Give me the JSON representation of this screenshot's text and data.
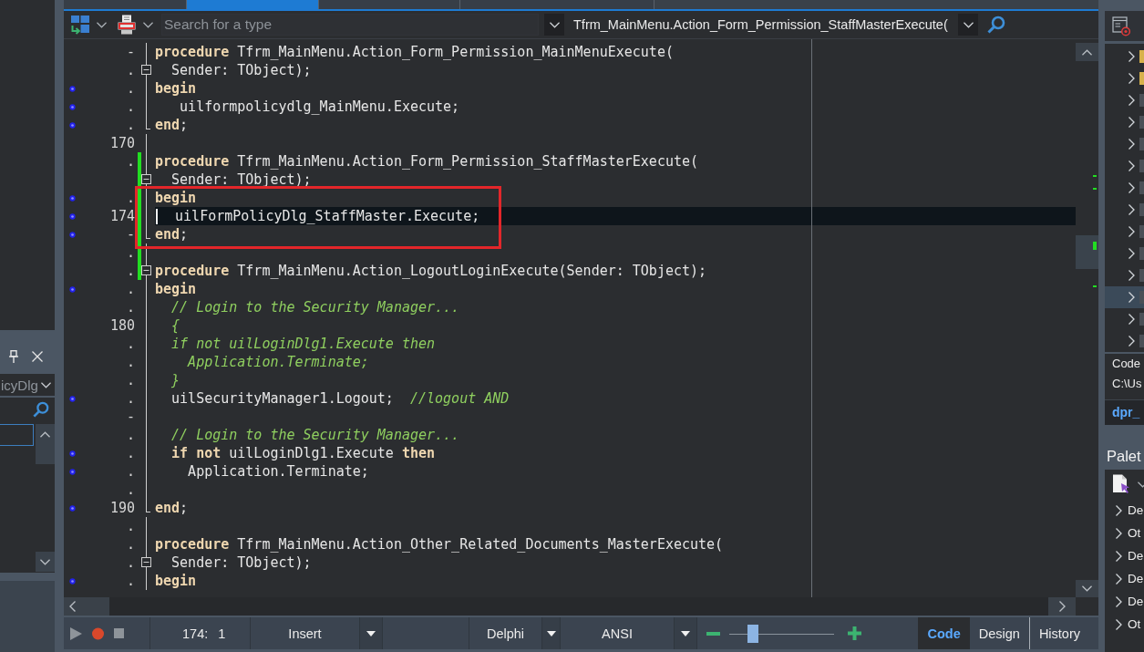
{
  "left_panel": {
    "combo": "icyDlg"
  },
  "editor_tabs": [
    {
      "selected": false
    },
    {
      "selected": true
    },
    {
      "selected": false
    },
    {
      "selected": false
    }
  ],
  "toolbar": {
    "search": {
      "placeholder": "Search for a type"
    },
    "method": "Tfrm_MainMenu.Action_Form_Permission_StaffMasterExecute("
  },
  "lines": [
    {
      "gutter": "-",
      "executable": false,
      "modified": false,
      "current": false,
      "kind": "line",
      "code": [
        {
          "kind": "keyword",
          "text": "procedure"
        },
        {
          "kind": "plain",
          "text": " Tfrm_MainMenu.Action_Form_Permission_MainMenuExecute("
        }
      ]
    },
    {
      "gutter": ".",
      "executable": false,
      "modified": false,
      "current": false,
      "kind": "box",
      "code": [
        {
          "kind": "plain",
          "text": "  Sender: TObject);"
        }
      ]
    },
    {
      "gutter": ".",
      "executable": true,
      "modified": false,
      "current": false,
      "kind": "line",
      "code": [
        {
          "kind": "keyword",
          "text": "begin"
        }
      ]
    },
    {
      "gutter": ".",
      "executable": true,
      "modified": false,
      "current": false,
      "kind": "line",
      "code": [
        {
          "kind": "plain",
          "text": "   uilformpolicydlg_MainMenu.Execute;"
        }
      ]
    },
    {
      "gutter": ".",
      "executable": true,
      "modified": false,
      "current": false,
      "kind": "end",
      "code": [
        {
          "kind": "keyword",
          "text": "end"
        },
        {
          "kind": "plain",
          "text": ";"
        }
      ]
    },
    {
      "gutter": "170",
      "executable": false,
      "modified": false,
      "current": false,
      "kind": "line"
    },
    {
      "gutter": ".",
      "executable": false,
      "modified": true,
      "current": false,
      "kind": "line",
      "code": [
        {
          "kind": "keyword",
          "text": "procedure"
        },
        {
          "kind": "plain",
          "text": " Tfrm_MainMenu.Action_Form_Permission_StaffMasterExecute("
        }
      ]
    },
    {
      "executable": false,
      "modified": true,
      "current": false,
      "kind": "box",
      "code": [
        {
          "kind": "plain",
          "text": "  Sender: TObject);"
        }
      ]
    },
    {
      "gutter": ".",
      "executable": true,
      "modified": true,
      "current": false,
      "kind": "line",
      "code": [
        {
          "kind": "keyword",
          "text": "begin"
        }
      ]
    },
    {
      "gutter": "174",
      "executable": true,
      "modified": true,
      "current": true,
      "kind": "line",
      "code": [
        {
          "kind": "plain",
          "text": "  uilFormPolicyDlg_StaffMaster.Execute;"
        }
      ]
    },
    {
      "gutter": "-",
      "executable": true,
      "modified": true,
      "current": false,
      "kind": "end",
      "code": [
        {
          "kind": "keyword",
          "text": "end"
        },
        {
          "kind": "plain",
          "text": ";"
        }
      ]
    },
    {
      "gutter": ".",
      "executable": false,
      "modified": true,
      "current": false,
      "kind": "line"
    },
    {
      "gutter": ".",
      "executable": false,
      "modified": true,
      "current": false,
      "kind": "box",
      "code": [
        {
          "kind": "keyword",
          "text": "procedure"
        },
        {
          "kind": "plain",
          "text": " Tfrm_MainMenu.Action_LogoutLoginExecute(Sender: TObject);"
        }
      ]
    },
    {
      "gutter": ".",
      "executable": true,
      "modified": false,
      "current": false,
      "kind": "line",
      "code": [
        {
          "kind": "keyword",
          "text": "begin"
        }
      ]
    },
    {
      "gutter": ".",
      "executable": false,
      "modified": false,
      "current": false,
      "kind": "line",
      "code": [
        {
          "kind": "comment",
          "text": "  // Login to the Security Manager..."
        }
      ]
    },
    {
      "gutter": "180",
      "executable": false,
      "modified": false,
      "current": false,
      "kind": "line",
      "code": [
        {
          "kind": "comment",
          "text": "  {"
        }
      ]
    },
    {
      "gutter": ".",
      "executable": false,
      "modified": false,
      "current": false,
      "kind": "line",
      "code": [
        {
          "kind": "comment",
          "text": "  if not uilLoginDlg1.Execute then"
        }
      ]
    },
    {
      "gutter": ".",
      "executable": false,
      "modified": false,
      "current": false,
      "kind": "line",
      "code": [
        {
          "kind": "comment",
          "text": "    Application.Terminate;"
        }
      ]
    },
    {
      "gutter": ".",
      "executable": false,
      "modified": false,
      "current": false,
      "kind": "line",
      "code": [
        {
          "kind": "comment",
          "text": "  }"
        }
      ]
    },
    {
      "gutter": ".",
      "executable": true,
      "modified": false,
      "current": false,
      "kind": "line",
      "code": [
        {
          "kind": "plain",
          "text": "  uilSecurityManager1.Logout;  "
        },
        {
          "kind": "comment",
          "text": "//logout AND"
        }
      ]
    },
    {
      "gutter": "-",
      "executable": false,
      "modified": false,
      "current": false,
      "kind": "line"
    },
    {
      "gutter": ".",
      "executable": false,
      "modified": false,
      "current": false,
      "kind": "line",
      "code": [
        {
          "kind": "comment",
          "text": "  // Login to the Security Manager..."
        }
      ]
    },
    {
      "gutter": ".",
      "executable": true,
      "modified": false,
      "current": false,
      "kind": "line",
      "code": [
        {
          "kind": "keyword",
          "text": "  if not"
        },
        {
          "kind": "plain",
          "text": " uilLoginDlg1.Execute "
        },
        {
          "kind": "keyword",
          "text": "then"
        }
      ]
    },
    {
      "gutter": ".",
      "executable": true,
      "modified": false,
      "current": false,
      "kind": "line",
      "code": [
        {
          "kind": "plain",
          "text": "    Application.Terminate;"
        }
      ]
    },
    {
      "gutter": ".",
      "executable": false,
      "modified": false,
      "current": false,
      "kind": "line"
    },
    {
      "gutter": "190",
      "executable": true,
      "modified": false,
      "current": false,
      "kind": "end",
      "code": [
        {
          "kind": "keyword",
          "text": "end"
        },
        {
          "kind": "plain",
          "text": ";"
        }
      ]
    },
    {
      "gutter": ".",
      "executable": false,
      "modified": false,
      "current": false,
      "kind": "line"
    },
    {
      "gutter": ".",
      "executable": false,
      "modified": false,
      "current": false,
      "kind": "line",
      "code": [
        {
          "kind": "keyword",
          "text": "procedure"
        },
        {
          "kind": "plain",
          "text": " Tfrm_MainMenu.Action_Other_Related_Documents_MasterExecute("
        }
      ]
    },
    {
      "gutter": ".",
      "executable": false,
      "modified": false,
      "current": false,
      "kind": "box",
      "code": [
        {
          "kind": "plain",
          "text": "  Sender: TObject);"
        }
      ]
    },
    {
      "gutter": ".",
      "executable": true,
      "modified": false,
      "current": false,
      "kind": "line",
      "code": [
        {
          "kind": "keyword",
          "text": "begin"
        }
      ]
    }
  ],
  "annotation": {
    "kind": "rectangle"
  },
  "status_bar": {
    "line": "174:",
    "column": "1",
    "mode": "Insert",
    "language": "Delphi",
    "encoding": "ANSI",
    "zoom": {
      "level": 0.23
    },
    "views": [
      {
        "label": "Code",
        "selected": true
      },
      {
        "label": "Design",
        "selected": false
      },
      {
        "label": "History",
        "selected": false
      }
    ]
  },
  "right_panel": {
    "tree": [
      {
        "kind": "folder",
        "selected": false
      },
      {
        "kind": "folder",
        "selected": false
      },
      {
        "kind": "file",
        "selected": false
      },
      {
        "kind": "file",
        "selected": false
      },
      {
        "kind": "file",
        "selected": false
      },
      {
        "kind": "file",
        "selected": false
      },
      {
        "kind": "file",
        "selected": false
      },
      {
        "kind": "file",
        "selected": false
      },
      {
        "kind": "file",
        "selected": false
      },
      {
        "kind": "file",
        "selected": false
      },
      {
        "kind": "file",
        "selected": false
      },
      {
        "kind": "file",
        "selected": true
      },
      {
        "kind": "file",
        "selected": false
      },
      {
        "kind": "file",
        "selected": false
      }
    ],
    "info": {
      "label": "Code",
      "path": "C:\\Us",
      "file": "dpr_"
    },
    "palette": {
      "title": "Palet",
      "items": [
        "De",
        "Ot",
        "De",
        "De",
        "De",
        "Ot"
      ]
    }
  }
}
